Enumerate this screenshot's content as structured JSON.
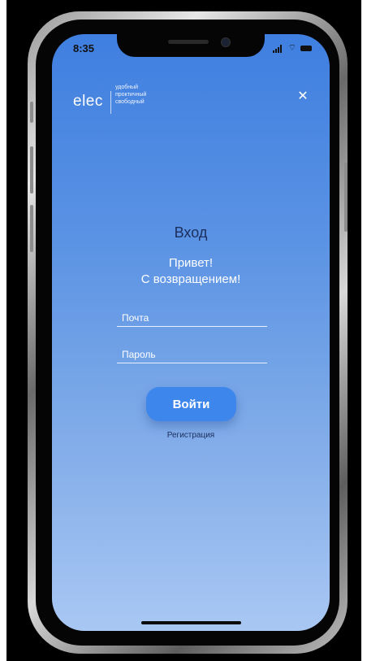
{
  "status_bar": {
    "time": "8:35",
    "icons": [
      "signal-icon",
      "wifi-icon",
      "battery-icon"
    ]
  },
  "header": {
    "logo_text": "elec",
    "tagline": [
      "удобный",
      "проктичный",
      "свободный"
    ],
    "close_icon": "✕"
  },
  "login": {
    "title": "Вход",
    "greeting_line1": "Привет!",
    "greeting_line2": "С возвращением!",
    "email_placeholder": "Почта",
    "password_placeholder": "Пароль",
    "submit_label": "Войти",
    "register_label": "Регистрация"
  },
  "colors": {
    "gradient_top": "#3f7fe0",
    "gradient_bottom": "#a9c7f3",
    "button": "#3c86ec",
    "title_text": "#1b2e5c"
  }
}
